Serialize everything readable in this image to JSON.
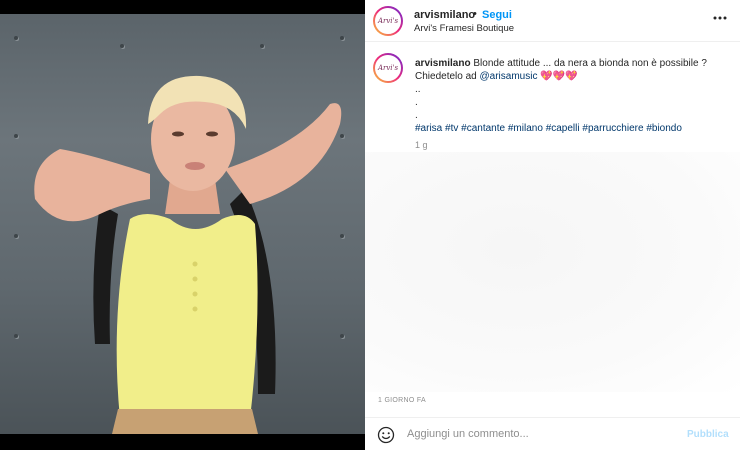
{
  "post": {
    "username": "arvismilano",
    "separator": "•",
    "follow_label": "Segui",
    "location": "Arvi's Framesi Boutique",
    "avatar_text": "Arvi's",
    "caption": {
      "username": "arvismilano",
      "line1": "Blonde attitude ... da nera a bionda non è possibile ?",
      "line2_prefix": "Chiedetelo ad",
      "mention": "@arisamusic",
      "emojis": "💖💖💖",
      "dots": [
        "..",
        ".",
        "."
      ],
      "hashtags": [
        "#arisa",
        "#tv",
        "#cantante",
        "#milano",
        "#capelli",
        "#parrucchiere",
        "#biondo"
      ],
      "time": "1 g"
    },
    "date": "1 GIORNO FA",
    "comment": {
      "placeholder": "Aggiungi un commento...",
      "publish_label": "Pubblica"
    }
  },
  "colors": {
    "link_blue": "#0095f6",
    "hashtag_blue": "#00376b",
    "publish_disabled": "#b2dffc",
    "top_wear": "#f1ee8a"
  },
  "icons": {
    "more": "more-dots-icon",
    "emoji": "emoji-icon"
  }
}
